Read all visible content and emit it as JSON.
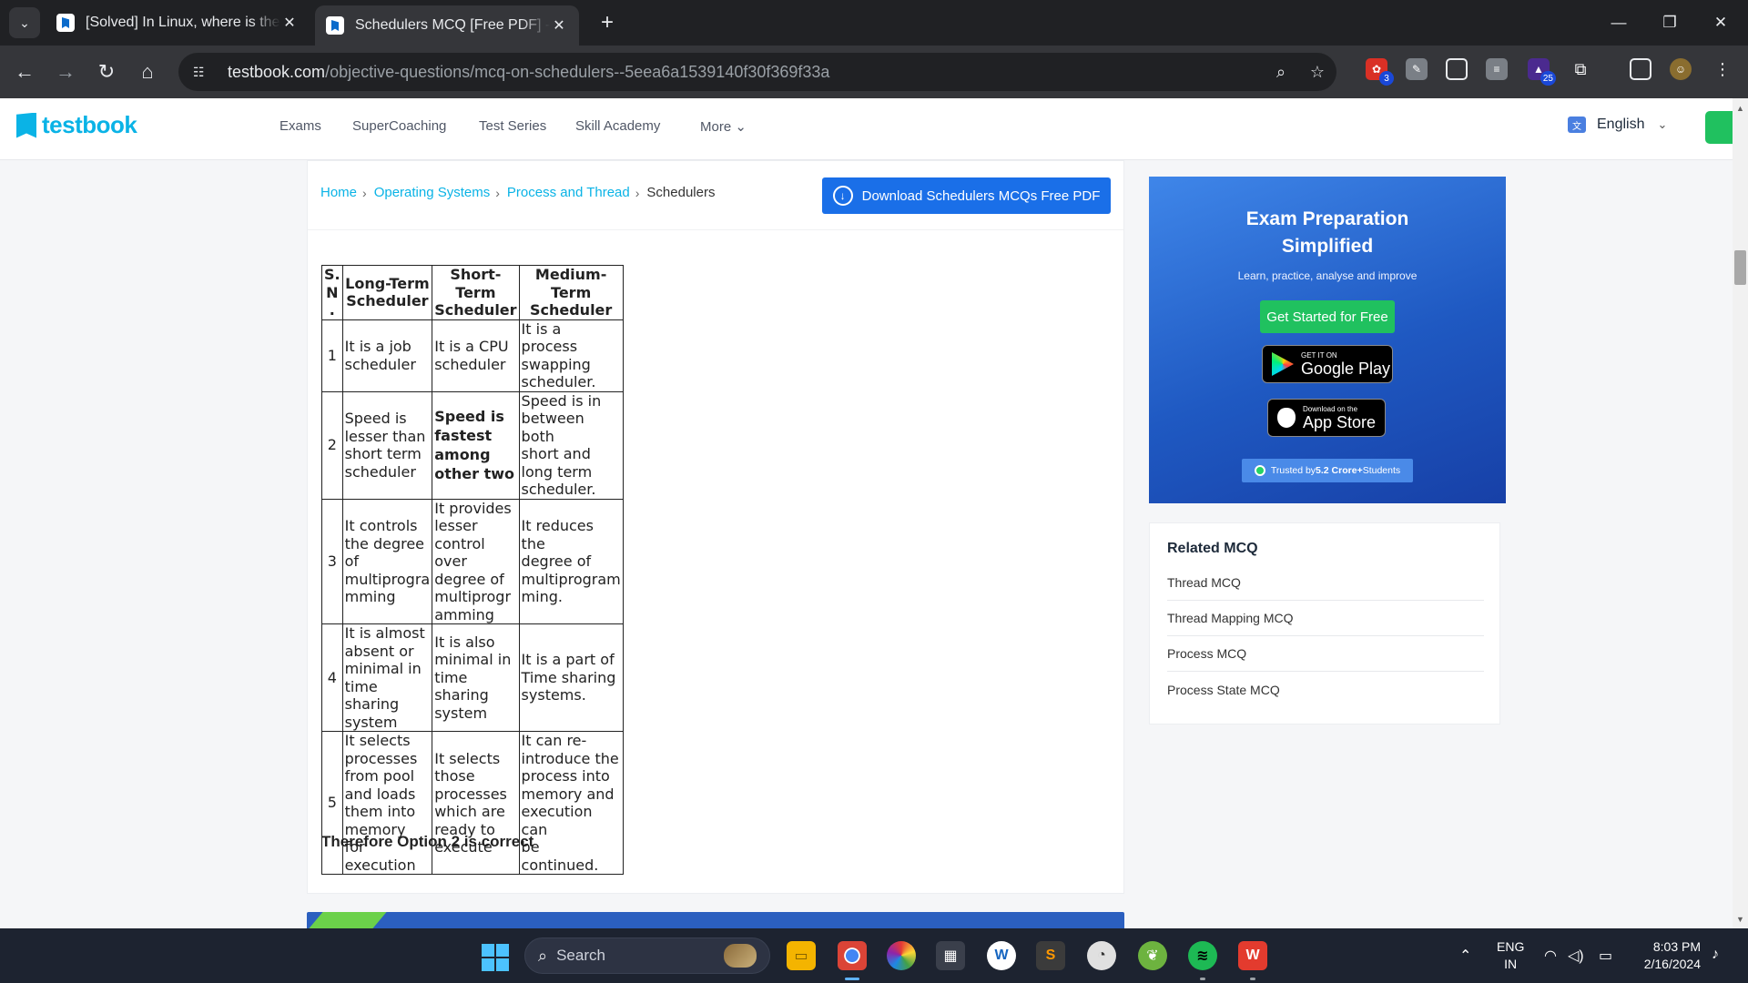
{
  "browser": {
    "tabs": [
      {
        "title": "[Solved] In Linux, where is the u",
        "active": false
      },
      {
        "title": "Schedulers MCQ [Free PDF] - O",
        "active": true
      }
    ],
    "url_host": "testbook.com",
    "url_path": "/objective-questions/mcq-on-schedulers--5eea6a1539140f30f369f33a",
    "extension_badges": {
      "ext1": "3",
      "ext2": "25"
    }
  },
  "site": {
    "logo_text": "testbook",
    "nav": [
      "Exams",
      "SuperCoaching",
      "Test Series",
      "Skill Academy",
      "More"
    ],
    "language": "English",
    "brand_color": "#0ab3e6"
  },
  "breadcrumb": {
    "items": [
      "Home",
      "Operating Systems",
      "Process and Thread"
    ],
    "current": "Schedulers"
  },
  "download_button": "Download Schedulers MCQs Free PDF",
  "table": {
    "headers": [
      [
        "S.",
        "N",
        "."
      ],
      [
        "Long-Term",
        "Scheduler"
      ],
      [
        "Short-",
        "Term",
        "Scheduler"
      ],
      [
        "Medium-",
        "Term",
        "Scheduler"
      ]
    ],
    "rows": [
      {
        "sn": "1",
        "cells": [
          [
            "It is a job",
            "scheduler"
          ],
          [
            "It is a CPU",
            "scheduler"
          ],
          [
            "It is a process",
            "swapping",
            "scheduler."
          ]
        ]
      },
      {
        "sn": "2",
        "cells": [
          [
            "Speed is",
            "lesser than",
            "short term",
            "scheduler"
          ],
          [
            "Speed is",
            "fastest",
            "among",
            "other two"
          ],
          [
            "Speed is in",
            "between both",
            "short and",
            "long term",
            "scheduler."
          ]
        ]
      },
      {
        "sn": "3",
        "cells": [
          [
            "It controls",
            "the degree",
            "of",
            "multiprogra",
            "mming"
          ],
          [
            "It provides",
            "lesser",
            "control",
            "over",
            "degree of",
            "multiprogr",
            "amming"
          ],
          [
            "It reduces the",
            "degree of",
            "multiprogram",
            "ming."
          ]
        ]
      },
      {
        "sn": "4",
        "cells": [
          [
            "It is almost",
            "absent or",
            "minimal in",
            "time sharing",
            "system"
          ],
          [
            "It is also",
            "minimal in",
            "time",
            "sharing",
            "system"
          ],
          [
            "It is a part of",
            "Time sharing",
            "systems."
          ]
        ]
      },
      {
        "sn": "5",
        "cells": [
          [
            "It selects",
            "processes",
            "from pool",
            "and loads",
            "them into",
            "memory for",
            "execution"
          ],
          [
            "It selects",
            "those",
            "processes",
            "which are",
            "ready to",
            "execute"
          ],
          [
            "It can re-",
            "introduce the",
            "process into",
            "memory and",
            "execution can",
            "be continued."
          ]
        ]
      }
    ]
  },
  "conclusion": "Therefore Option 2 is correct",
  "promo": {
    "title_line1": "Exam Preparation",
    "title_line2": "Simplified",
    "subtitle": "Learn, practice, analyse and improve",
    "cta": "Get Started for Free",
    "google_small": "GET IT ON",
    "google_big": "Google Play",
    "apple_small": "Download on the",
    "apple_big": "App Store",
    "trusted_prefix": "Trusted by ",
    "trusted_bold": "5.2 Crore+",
    "trusted_suffix": " Students"
  },
  "related": {
    "title": "Related MCQ",
    "items": [
      "Thread MCQ",
      "Thread Mapping MCQ",
      "Process MCQ",
      "Process State MCQ"
    ]
  },
  "taskbar": {
    "search_placeholder": "Search",
    "lang_line1": "ENG",
    "lang_line2": "IN",
    "time": "8:03 PM",
    "date": "2/16/2024"
  }
}
